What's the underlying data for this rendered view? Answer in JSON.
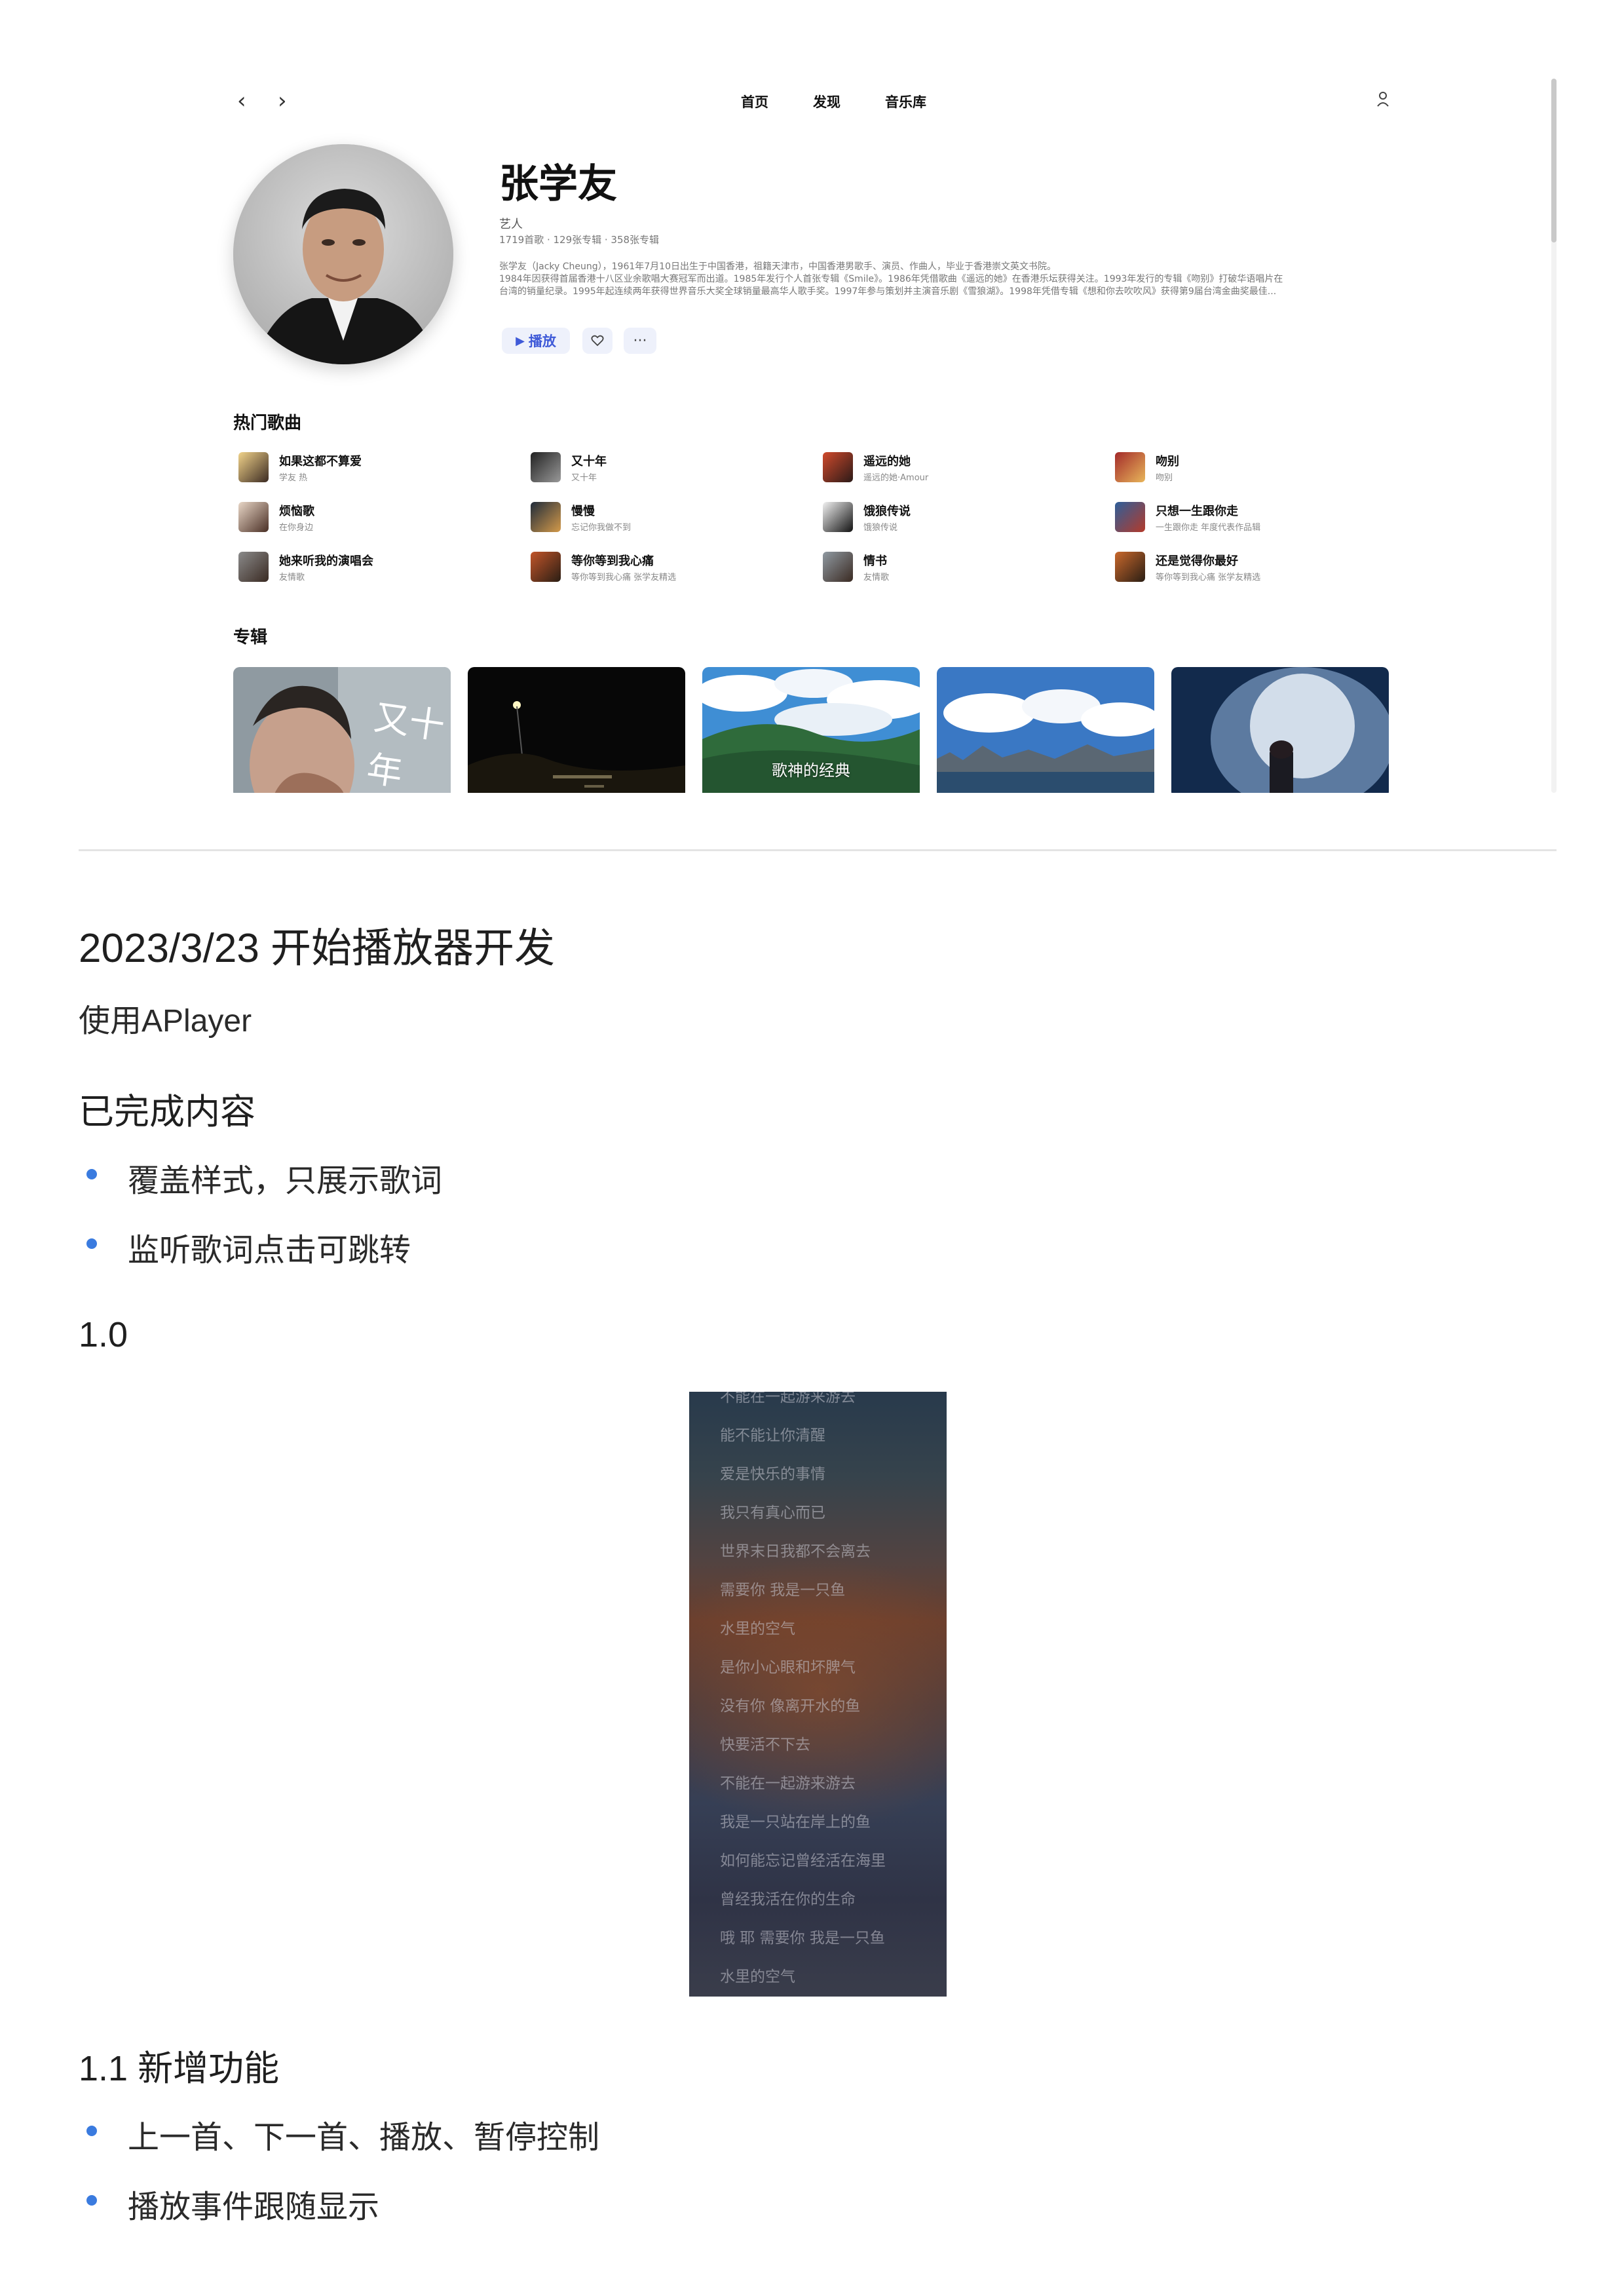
{
  "app": {
    "nav": {
      "back_icon": "chevron-left-icon",
      "forward_icon": "chevron-right-icon",
      "links": [
        "首页",
        "发现",
        "音乐库"
      ],
      "user_icon": "user-icon"
    },
    "artist": {
      "name": "张学友",
      "type": "艺人",
      "stats": "1719首歌 · 129张专辑 · 358张专辑",
      "bio_lines": [
        "张学友（Jacky Cheung），1961年7月10日出生于中国香港，祖籍天津市，中国香港男歌手、演员、作曲人，毕业于香港崇文英文书院。",
        "1984年因获得首届香港十八区业余歌唱大赛冠军而出道。1985年发行个人首张专辑《Smile》。1986年凭借歌曲《遥远的她》在香港乐坛获得关注。1993年发行的专辑《吻别》打破华语唱片在",
        "台湾的销量纪录。1995年起连续两年获得世界音乐大奖全球销量最高华人歌手奖。1997年参与策划并主演音乐剧《雪狼湖》。1998年凭借专辑《想和你去吹吹风》获得第9届台湾金曲奖最佳..."
      ],
      "play_label": "播放"
    },
    "hot_songs": {
      "title": "热门歌曲",
      "songs": [
        {
          "name": "如果这都不算爱",
          "sub": "学友 热"
        },
        {
          "name": "又十年",
          "sub": "又十年"
        },
        {
          "name": "遥远的她",
          "sub": "遥远的她·Amour"
        },
        {
          "name": "吻别",
          "sub": "吻别"
        },
        {
          "name": "烦恼歌",
          "sub": "在你身边"
        },
        {
          "name": "慢慢",
          "sub": "忘记你我做不到"
        },
        {
          "name": "饿狼传说",
          "sub": "饿狼传说"
        },
        {
          "name": "只想一生跟你走",
          "sub": "一生跟你走 年度代表作品辑"
        },
        {
          "name": "她来听我的演唱会",
          "sub": "友情歌"
        },
        {
          "name": "等你等到我心痛",
          "sub": "等你等到我心痛 张学友精选"
        },
        {
          "name": "情书",
          "sub": "友情歌"
        },
        {
          "name": "还是觉得你最好",
          "sub": "等你等到我心痛 张学友精选"
        }
      ]
    },
    "albums": {
      "title": "专辑",
      "items": [
        {
          "caption": "又十年"
        },
        {
          "caption": ""
        },
        {
          "caption": "歌神的经典"
        },
        {
          "caption": ""
        },
        {
          "caption": ""
        }
      ]
    }
  },
  "doc": {
    "heading": "2023/3/23 开始播放器开发",
    "intro": "使用APlayer",
    "done_heading": "已完成内容",
    "done_items": [
      "覆盖样式，只展示歌词",
      "监听歌词点击可跳转"
    ],
    "version_1_0": "1.0",
    "version_1_1_heading": "1.1 新增功能",
    "v11_items": [
      "上一首、下一首、播放、暂停控制",
      "播放事件跟随显示"
    ]
  },
  "lyrics": [
    "不能在一起游来游去",
    "能不能让你清醒",
    "爱是快乐的事情",
    "我只有真心而已",
    "世界末日我都不会离去",
    "需要你 我是一只鱼",
    "水里的空气",
    "是你小心眼和坏脾气",
    "没有你 像离开水的鱼",
    "快要活不下去",
    "不能在一起游来游去",
    "我是一只站在岸上的鱼",
    "如何能忘记曾经活在海里",
    "曾经我活在你的生命",
    "哦 耶 需要你 我是一只鱼",
    "水里的空气"
  ],
  "colors": {
    "accent": "#3f5ad8",
    "bullet": "#3a7bdf"
  }
}
